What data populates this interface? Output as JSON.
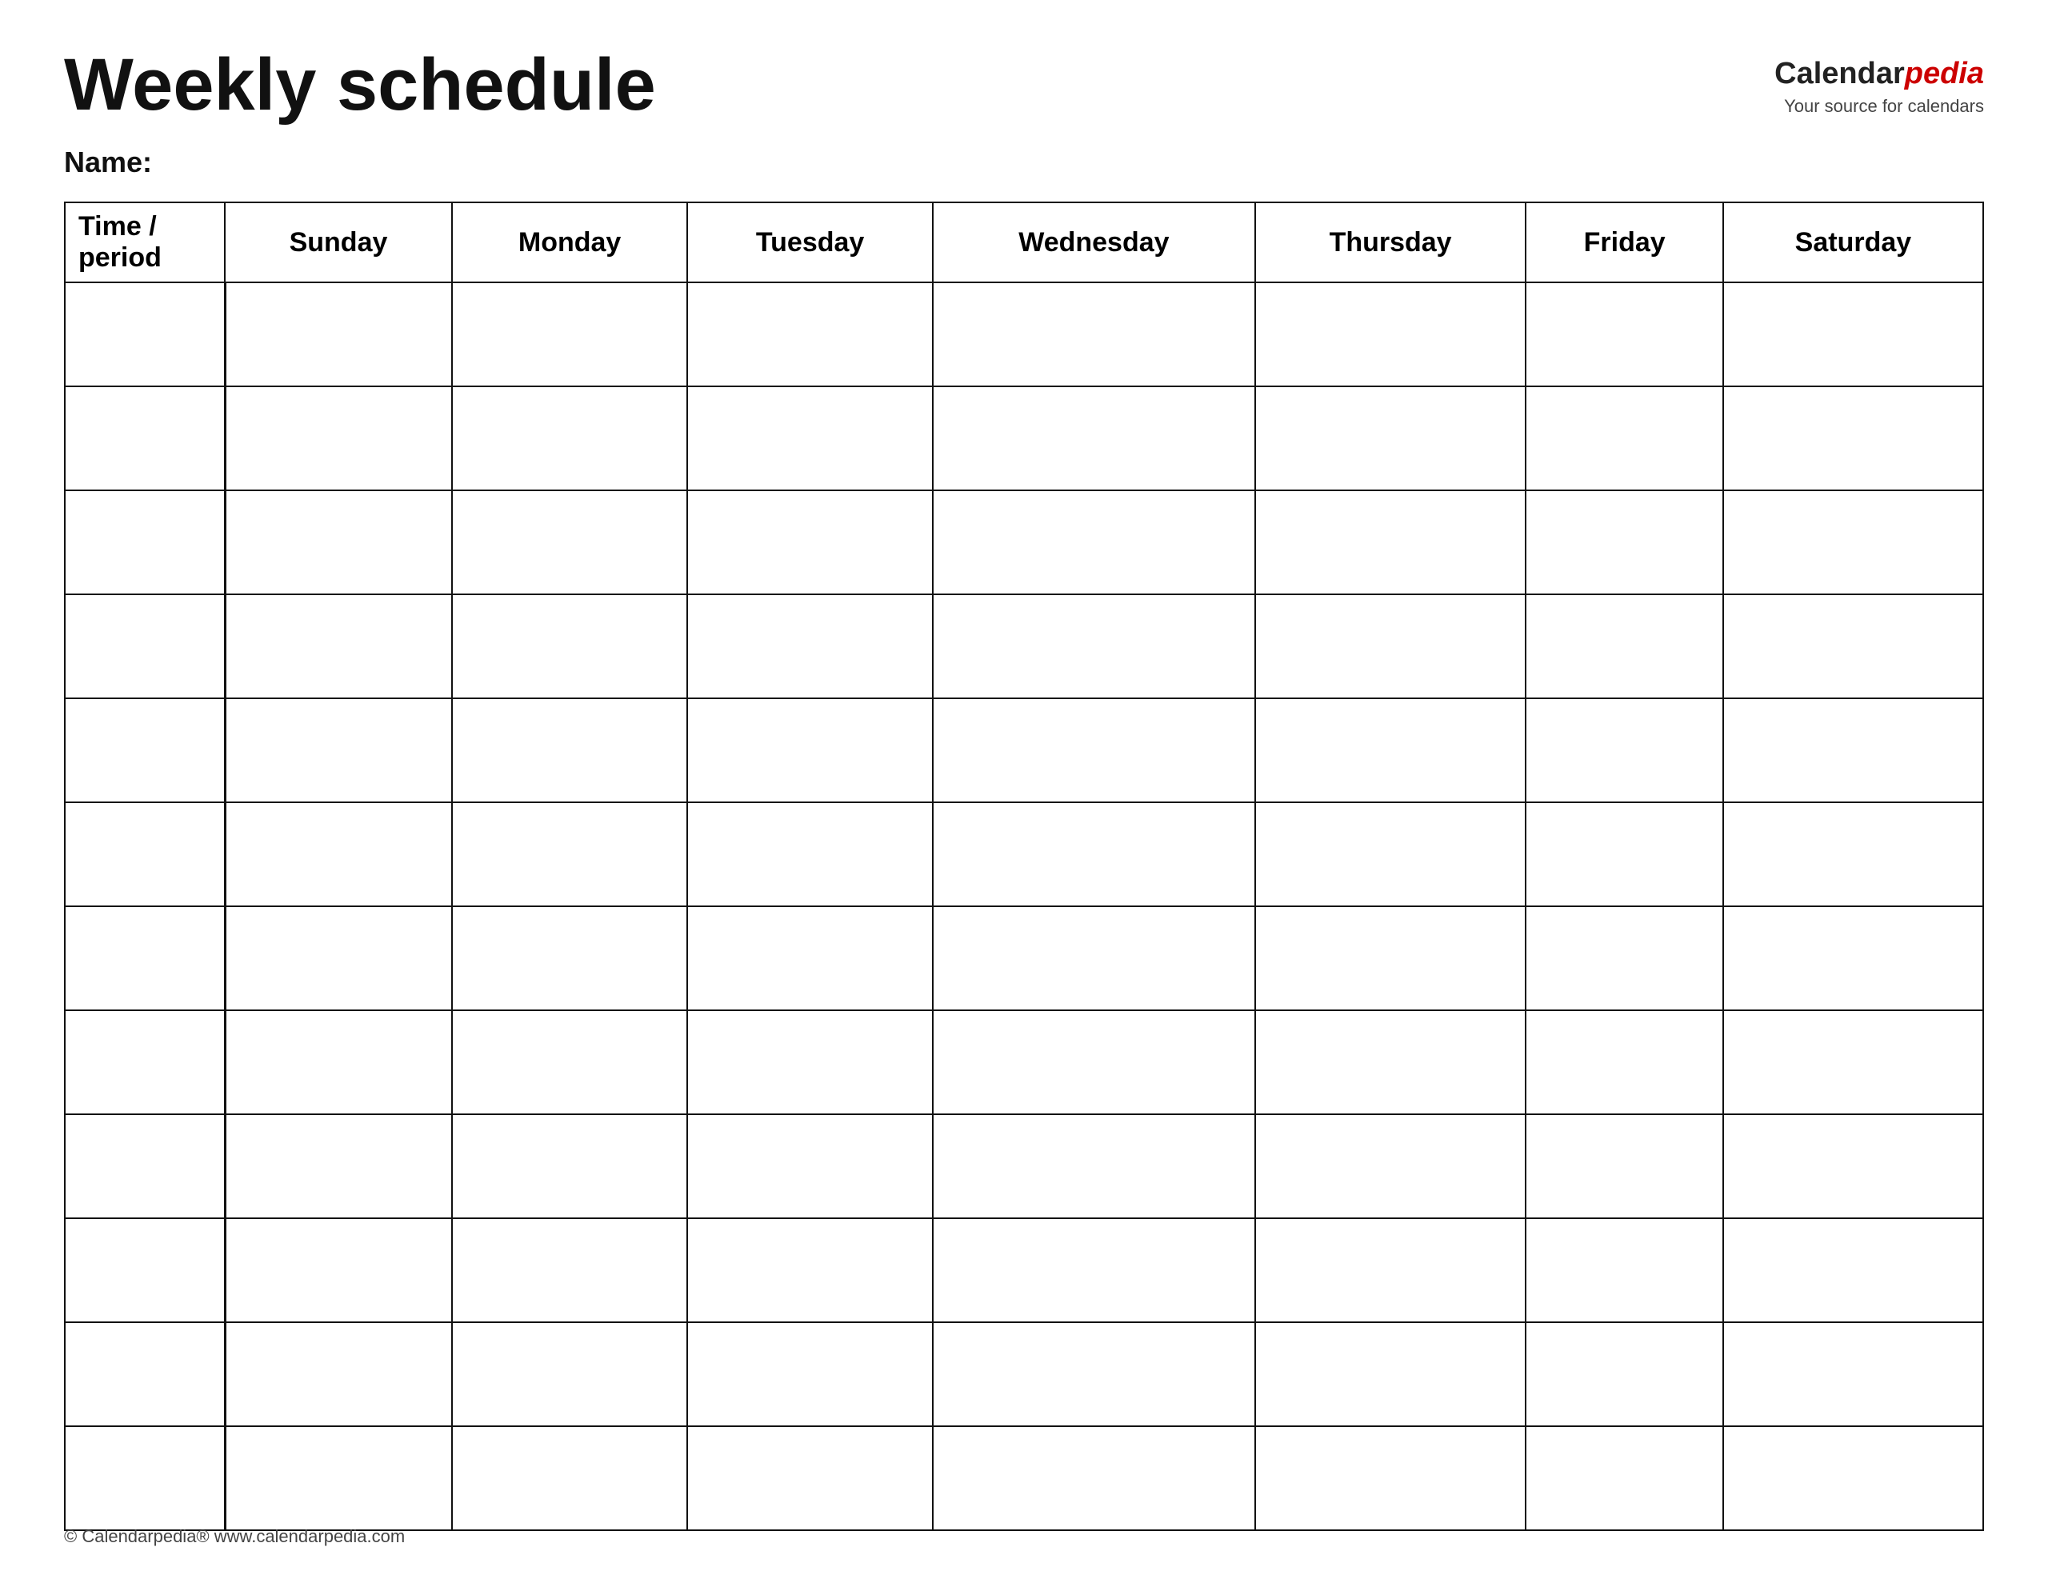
{
  "header": {
    "title": "Weekly schedule",
    "logo": {
      "calendar": "Calendar",
      "pedia": "pedia",
      "subtitle": "Your source for calendars"
    }
  },
  "name_label": "Name:",
  "table": {
    "columns": [
      "Time / period",
      "Sunday",
      "Monday",
      "Tuesday",
      "Wednesday",
      "Thursday",
      "Friday",
      "Saturday"
    ],
    "row_count": 12
  },
  "footer": {
    "text": "© Calendarpedia®  www.calendarpedia.com"
  }
}
